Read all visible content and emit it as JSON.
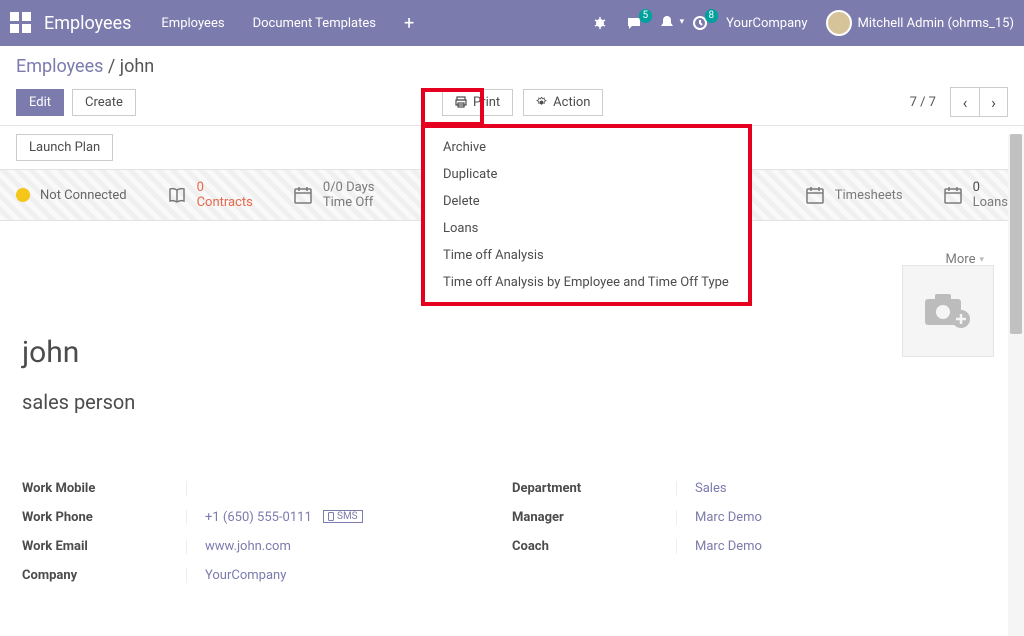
{
  "nav": {
    "app_title": "Employees",
    "menu1": "Employees",
    "menu2": "Document Templates",
    "company": "YourCompany",
    "user": "Mitchell Admin (ohrms_15)",
    "chat_badge": "5",
    "activity_badge": "8"
  },
  "breadcrumb": {
    "root": "Employees",
    "sep": "/",
    "leaf": "john"
  },
  "buttons": {
    "edit": "Edit",
    "create": "Create",
    "print": "Print",
    "action": "Action",
    "launch_plan": "Launch Plan"
  },
  "pager": {
    "label": "7 / 7"
  },
  "stats": {
    "not_connected": "Not Connected",
    "contracts_n": "0",
    "contracts_l": "Contracts",
    "timeoff_n": "0/0 Days",
    "timeoff_l": "Time Off",
    "timesheets": "Timesheets",
    "loans_n": "0",
    "loans_l": "Loans",
    "more": "More"
  },
  "action_menu": {
    "archive": "Archive",
    "duplicate": "Duplicate",
    "delete": "Delete",
    "loans": "Loans",
    "toa": "Time off Analysis",
    "toa_by": "Time off Analysis by Employee and Time Off Type"
  },
  "form": {
    "name": "john",
    "title": "sales person",
    "fields_left": {
      "work_mobile_l": "Work Mobile",
      "work_mobile_v": "",
      "work_phone_l": "Work Phone",
      "work_phone_v": "+1 (650) 555-0111",
      "sms": "SMS",
      "work_email_l": "Work Email",
      "work_email_v": "www.john.com",
      "company_l": "Company",
      "company_v": "YourCompany"
    },
    "fields_right": {
      "department_l": "Department",
      "department_v": "Sales",
      "manager_l": "Manager",
      "manager_v": "Marc Demo",
      "coach_l": "Coach",
      "coach_v": "Marc Demo"
    }
  }
}
